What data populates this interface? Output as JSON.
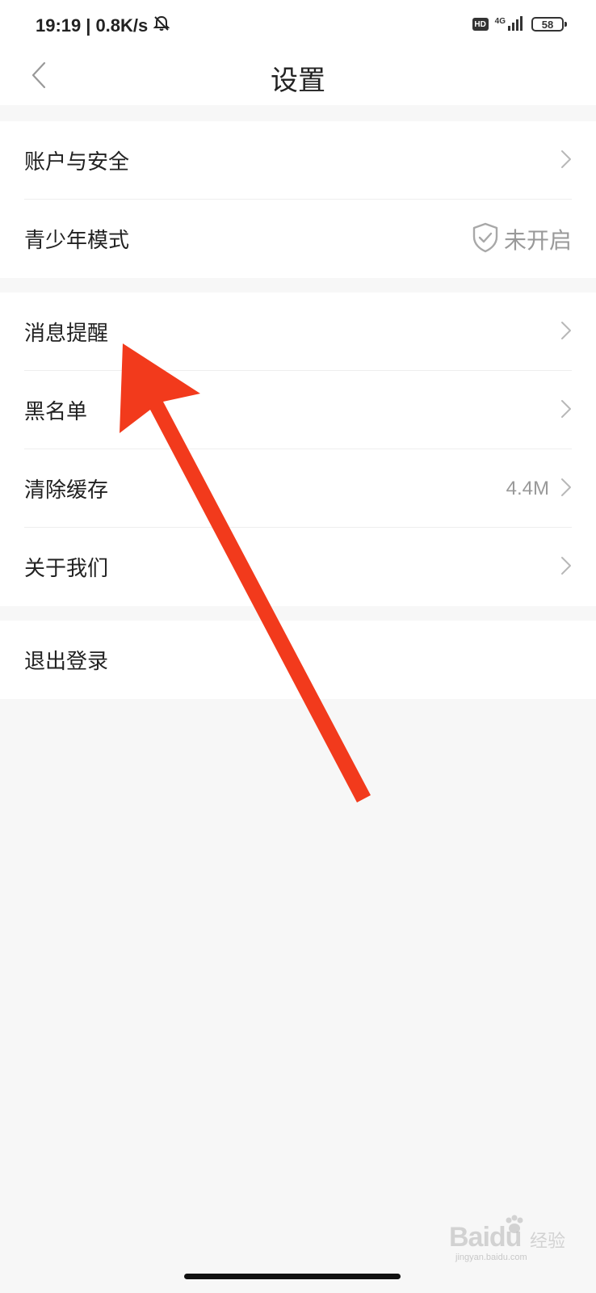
{
  "status_bar": {
    "time": "19:19",
    "separator": "|",
    "net_speed": "0.8K/s",
    "network_type": "4G",
    "hd_label": "HD",
    "battery": "58",
    "icons": [
      "bell-muted-icon",
      "hd-icon",
      "signal-icon",
      "battery-icon"
    ]
  },
  "nav": {
    "title": "设置",
    "back_icon": "chevron-left-icon"
  },
  "groups": {
    "account": {
      "account_security": "账户与安全",
      "teen_mode": "青少年模式",
      "teen_mode_status": "未开启"
    },
    "general": {
      "notifications": "消息提醒",
      "blacklist": "黑名单",
      "clear_cache": "清除缓存",
      "cache_size": "4.4M",
      "about_us": "关于我们"
    },
    "logout": {
      "label": "退出登录"
    }
  },
  "annotation": {
    "arrow_color": "#f23a1c"
  },
  "watermark": {
    "brand": "Baidu",
    "brand_cn": "经验",
    "url": "jingyan.baidu.com"
  },
  "colors": {
    "background": "#f7f7f7",
    "card": "#ffffff",
    "text_primary": "#222222",
    "text_secondary": "#999999",
    "divider": "#eeeeee"
  }
}
